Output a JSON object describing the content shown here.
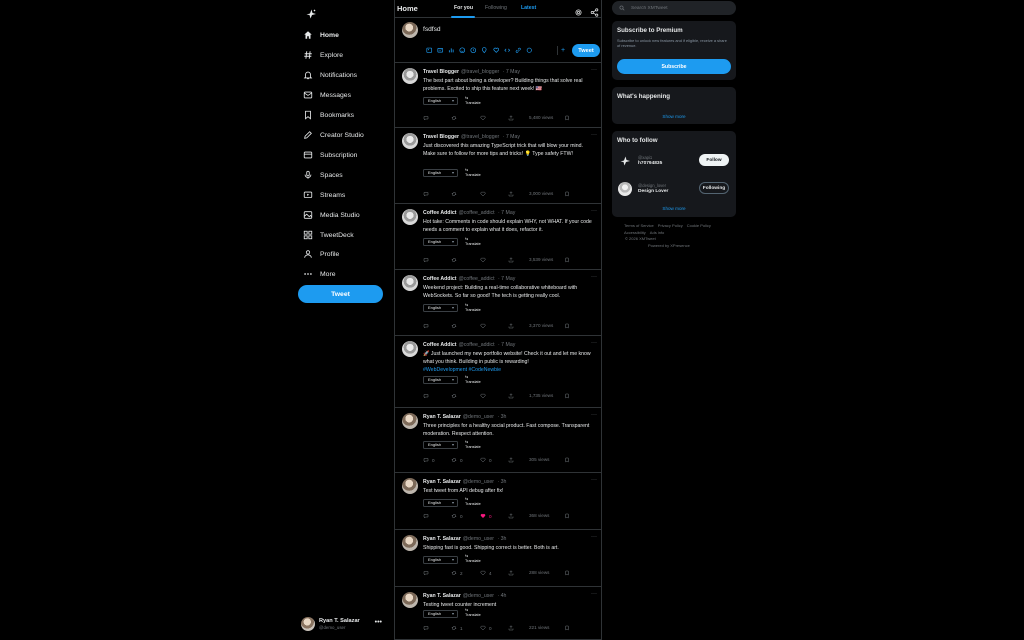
{
  "nav": {
    "logo_icon": "app-logo-icon",
    "items": [
      {
        "label": "Home",
        "icon": "home-icon",
        "active": true
      },
      {
        "label": "Explore",
        "icon": "hashtag-icon"
      },
      {
        "label": "Notifications",
        "icon": "bell-icon"
      },
      {
        "label": "Messages",
        "icon": "envelope-icon"
      },
      {
        "label": "Bookmarks",
        "icon": "bookmark-icon"
      },
      {
        "label": "Creator Studio",
        "icon": "pencil-icon"
      },
      {
        "label": "Subscription",
        "icon": "card-icon"
      },
      {
        "label": "Spaces",
        "icon": "mic-icon"
      },
      {
        "label": "Streams",
        "icon": "streams-icon"
      },
      {
        "label": "Media Studio",
        "icon": "media-icon"
      },
      {
        "label": "TweetDeck",
        "icon": "grid-icon"
      },
      {
        "label": "Profile",
        "icon": "person-icon"
      },
      {
        "label": "More",
        "icon": "more-icon"
      }
    ],
    "tweet_button": "Tweet",
    "account": {
      "name": "Ryan T. Salazar",
      "handle": "@demo_user",
      "more": "•••"
    }
  },
  "header": {
    "title": "Home",
    "tabs": [
      "For you",
      "Following",
      "Latest"
    ],
    "active_tab": "For you"
  },
  "composer": {
    "value": "fsdfsd",
    "tweet_button": "Tweet",
    "add_label": "+",
    "tools": [
      "image-icon",
      "gif-icon",
      "poll-icon",
      "emoji-icon",
      "schedule-icon",
      "location-icon",
      "heart-icon",
      "code-icon",
      "link-icon",
      "circle-icon"
    ]
  },
  "tweets": [
    {
      "name": "Travel Blogger",
      "handle": "@travel_blogger",
      "time": "· 7 May",
      "text": "The best part about being a developer? Building things that solve real problems. Excited to ship this feature next week! 🇺🇸",
      "hashtags": "",
      "language": "English",
      "translate_a": "⇆",
      "translate_b": "Translate",
      "views": "5,480 views",
      "replies": "",
      "retweets": "",
      "likes": "",
      "liked": false
    },
    {
      "name": "Travel Blogger",
      "handle": "@travel_blogger",
      "time": "· 7 May",
      "text": "Just discovered this amazing TypeScript trick that will blow your mind. Make sure to follow for more tips and tricks! 💡 Type safety FTW!",
      "hashtags": "",
      "language": "English",
      "translate_a": "⇆",
      "translate_b": "Translate",
      "views": "3,000 views",
      "replies": "",
      "retweets": "",
      "likes": "",
      "liked": false
    },
    {
      "name": "Coffee Addict",
      "handle": "@coffee_addict",
      "time": "· 7 May",
      "text": "Hot take: Comments in code should explain WHY, not WHAT. If your code needs a comment to explain what it does, refactor it.",
      "hashtags": "",
      "language": "English",
      "translate_a": "⇆",
      "translate_b": "Translate",
      "views": "3,539 views",
      "replies": "",
      "retweets": "",
      "likes": "",
      "liked": false
    },
    {
      "name": "Coffee Addict",
      "handle": "@coffee_addict",
      "time": "· 7 May",
      "text": "Weekend project: Building a real-time collaborative whiteboard with WebSockets. So far so good! The tech is getting really cool.",
      "hashtags": "",
      "language": "English",
      "translate_a": "⇆",
      "translate_b": "Translate",
      "views": "3,370 views",
      "replies": "",
      "retweets": "",
      "likes": "",
      "liked": false
    },
    {
      "name": "Coffee Addict",
      "handle": "@coffee_addict",
      "time": "· 7 May",
      "text": "🚀 Just launched my new portfolio website! Check it out and let me know what you think. Building in public is rewarding!",
      "hashtags": "#WebDevelopment #CodeNewbie",
      "language": "English",
      "translate_a": "⇆",
      "translate_b": "Translate",
      "views": "1,735 views",
      "replies": "",
      "retweets": "",
      "likes": "",
      "liked": false
    },
    {
      "name": "Ryan T. Salazar",
      "handle": "@demo_user",
      "time": "· 3h",
      "text": "Three principles for a healthy social product. Fast compose. Transparent moderation. Respect attention.",
      "hashtags": "",
      "language": "English",
      "translate_a": "⇆",
      "translate_b": "Translate",
      "views": "305 views",
      "replies": "0",
      "retweets": "0",
      "likes": "0",
      "liked": false
    },
    {
      "name": "Ryan T. Salazar",
      "handle": "@demo_user",
      "time": "· 3h",
      "text": "Test tweet from API debug after fix!",
      "hashtags": "",
      "language": "English",
      "translate_a": "⇆",
      "translate_b": "Translate",
      "views": "368 views",
      "replies": "",
      "retweets": "0",
      "likes": "0",
      "liked": true
    },
    {
      "name": "Ryan T. Salazar",
      "handle": "@demo_user",
      "time": "· 3h",
      "text": "Shipping fast is good. Shipping correct is better. Both is art.",
      "hashtags": "",
      "language": "English",
      "translate_a": "⇆",
      "translate_b": "Translate",
      "views": "288 views",
      "replies": "",
      "retweets": "2",
      "likes": "4",
      "liked": false
    },
    {
      "name": "Ryan T. Salazar",
      "handle": "@demo_user",
      "time": "· 4h",
      "text": "Testing tweet counter increment",
      "hashtags": "",
      "language": "English",
      "translate_a": "⇆",
      "translate_b": "Translate",
      "views": "221 views",
      "replies": "",
      "retweets": "1",
      "likes": "0",
      "liked": false
    }
  ],
  "right": {
    "search_placeholder": "Search XMTweet",
    "premium": {
      "title": "Subscribe to Premium",
      "desc": "Subscribe to unlock new features and if eligible, receive a share of revenue.",
      "button": "Subscribe"
    },
    "happening": {
      "title": "What's happening",
      "show_more": "Show more"
    },
    "who_to_follow": {
      "title": "Who to follow",
      "users": [
        {
          "line1": "@xapi1",
          "line2": "h70794835",
          "button": "Follow"
        },
        {
          "line1": "@design_lover",
          "line2": "Design Lover",
          "button": "Following"
        }
      ],
      "show_more": "Show more"
    },
    "footer": {
      "links": [
        "Terms of Service",
        "Privacy Policy",
        "Cookie Policy",
        "Accessibility",
        "Ads info"
      ],
      "copyright": "© 2026 XMTweet",
      "powered": "Powered by XPresence"
    }
  },
  "colors": {
    "accent": "#1d9bf0",
    "like": "#f91880",
    "background": "#000000",
    "card": "#16181c"
  }
}
